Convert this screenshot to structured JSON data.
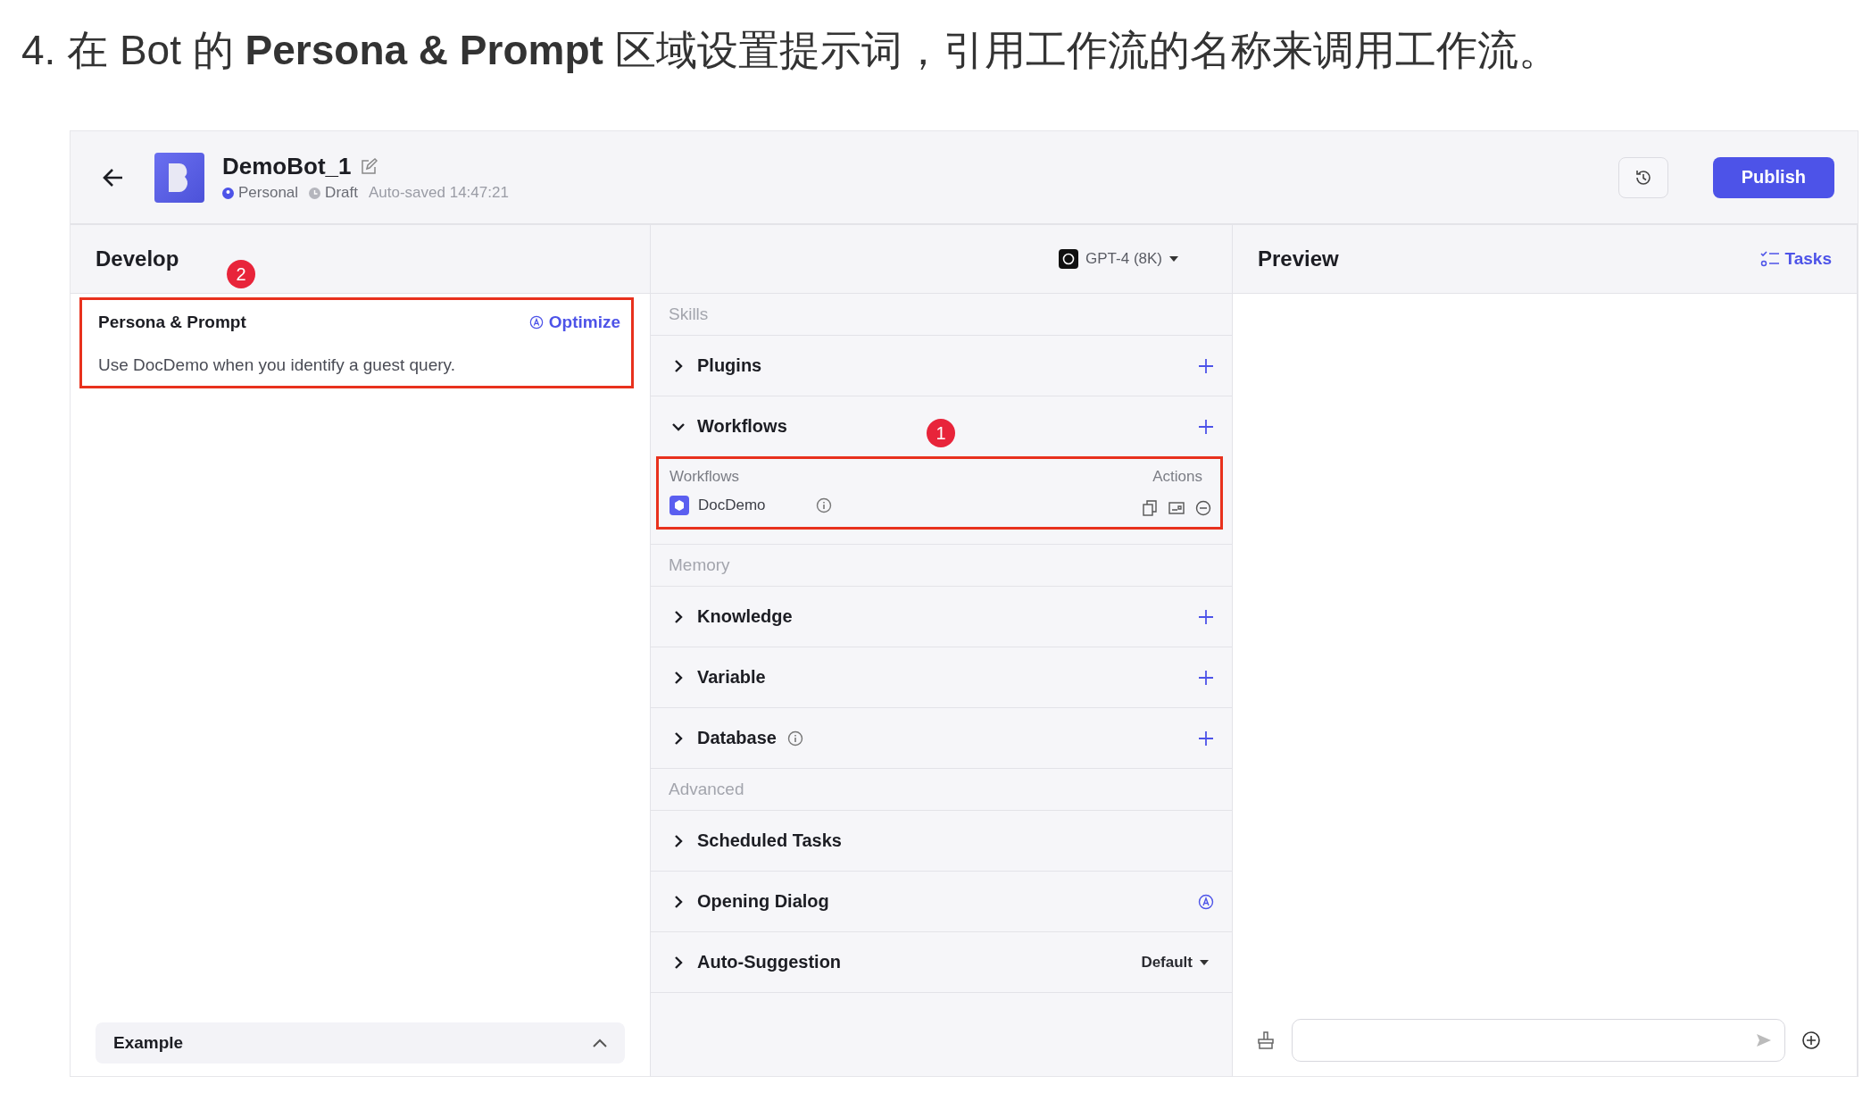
{
  "heading": "4. 在 Bot 的 **Persona & Prompt** 区域设置提示词，引用工作流的名称来调用工作流。",
  "bot": {
    "name": "DemoBot_1",
    "tags": [
      {
        "kind": "personal",
        "label": "Personal"
      },
      {
        "kind": "draft",
        "label": "Draft"
      }
    ],
    "autosaved": "Auto-saved 14:47:21",
    "publish": "Publish"
  },
  "develop": {
    "title": "Develop",
    "model": "GPT-4 (8K)",
    "persona": {
      "title": "Persona & Prompt",
      "optimize": "Optimize",
      "prompt": "Use DocDemo when you identify a guest query.",
      "callout": "2"
    },
    "example": {
      "label": "Example",
      "expanded": true
    },
    "groups": [
      {
        "label": "Skills",
        "items": [
          {
            "label": "Plugins",
            "expanded": false,
            "kind": "add"
          },
          {
            "label": "Workflows",
            "expanded": true,
            "kind": "add",
            "callout": "1",
            "table": {
              "columns": [
                "Workflows",
                "Actions"
              ],
              "rows": [
                {
                  "name": "DocDemo"
                }
              ]
            }
          }
        ]
      },
      {
        "label": "Memory",
        "items": [
          {
            "label": "Knowledge",
            "expanded": false,
            "kind": "add"
          },
          {
            "label": "Variable",
            "expanded": false,
            "kind": "add"
          },
          {
            "label": "Database",
            "expanded": false,
            "kind": "add",
            "info": true
          }
        ]
      },
      {
        "label": "Advanced",
        "items": [
          {
            "label": "Scheduled Tasks",
            "expanded": false,
            "kind": "plain"
          },
          {
            "label": "Opening Dialog",
            "expanded": false,
            "kind": "auto"
          },
          {
            "label": "Auto-Suggestion",
            "expanded": false,
            "kind": "dropdown",
            "value": "Default"
          }
        ]
      }
    ]
  },
  "preview": {
    "title": "Preview",
    "tasks": "Tasks"
  }
}
